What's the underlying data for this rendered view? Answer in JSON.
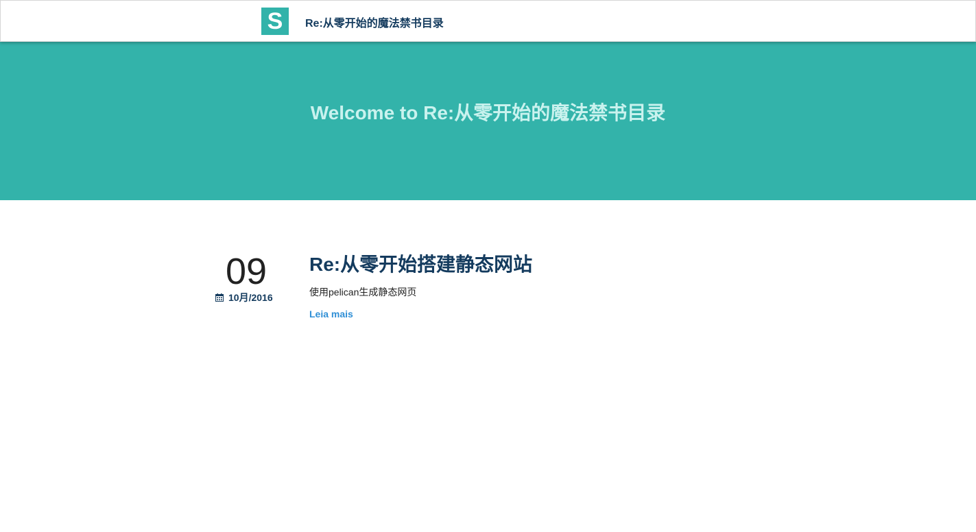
{
  "navbar": {
    "logo_letter": "S",
    "site_title": "Re:从零开始的魔法禁书目录"
  },
  "hero": {
    "title": "Welcome to Re:从零开始的魔法禁书目录"
  },
  "posts": [
    {
      "day": "09",
      "month_year": "10月/2016",
      "date_icon": "calendar-icon",
      "title": "Re:从零开始搭建静态网站",
      "summary": "使用pelican生成静态网页",
      "read_more_label": "Leia mais"
    }
  ],
  "colors": {
    "accent": "#33b3aa",
    "title_text": "#143b5e",
    "hero_text": "#c9f2ee",
    "link": "#2f8fd6"
  }
}
